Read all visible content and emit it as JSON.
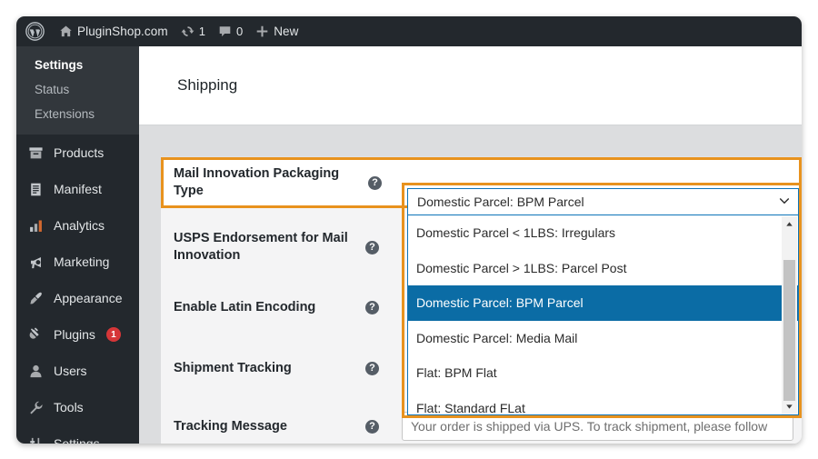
{
  "adminbar": {
    "logo_icon": "wordpress-logo-icon",
    "home_icon": "home-icon",
    "site_name": "PluginShop.com",
    "updates_icon": "updates-icon",
    "updates_count": "1",
    "comments_icon": "comments-icon",
    "comments_count": "0",
    "new_icon": "plus-icon",
    "new_label": "New"
  },
  "sidebar": {
    "submenu": [
      {
        "label": "Settings",
        "current": true
      },
      {
        "label": "Status",
        "current": false
      },
      {
        "label": "Extensions",
        "current": false
      }
    ],
    "items": [
      {
        "label": "Products",
        "icon": "products-icon"
      },
      {
        "label": "Manifest",
        "icon": "manifest-icon"
      },
      {
        "label": "Analytics",
        "icon": "analytics-icon"
      },
      {
        "label": "Marketing",
        "icon": "marketing-icon"
      },
      {
        "label": "Appearance",
        "icon": "appearance-icon"
      },
      {
        "label": "Plugins",
        "icon": "plugins-icon",
        "badge": "1"
      },
      {
        "label": "Users",
        "icon": "users-icon"
      },
      {
        "label": "Tools",
        "icon": "tools-icon"
      },
      {
        "label": "Settings",
        "icon": "settings-icon"
      }
    ]
  },
  "page": {
    "title": "Shipping"
  },
  "form": {
    "help_glyph": "?",
    "rows": [
      {
        "label": "Mail Innovation Packaging Type"
      },
      {
        "label": "USPS Endorsement for Mail Innovation"
      },
      {
        "label": "Enable Latin Encoding"
      },
      {
        "label": "Shipment Tracking"
      },
      {
        "label": "Tracking Message"
      }
    ]
  },
  "dropdown": {
    "selected_value": "Domestic Parcel: BPM Parcel",
    "chevron_icon": "chevron-down-icon",
    "scroll_up_icon": "scroll-up-arrow-icon",
    "scroll_down_icon": "scroll-down-arrow-icon",
    "options": [
      {
        "label": "Domestic Parcel < 1LBS: Irregulars",
        "selected": false
      },
      {
        "label": "Domestic Parcel > 1LBS: Parcel Post",
        "selected": false
      },
      {
        "label": "Domestic Parcel: BPM Parcel",
        "selected": true
      },
      {
        "label": "Domestic Parcel: Media Mail",
        "selected": false
      },
      {
        "label": "Flat: BPM Flat",
        "selected": false
      },
      {
        "label": "Flat: Standard FLat",
        "selected": false
      }
    ]
  },
  "tracking_message": {
    "value": "Your order is shipped via UPS. To track shipment, please follow"
  },
  "colors": {
    "highlight_orange": "#e8921e",
    "select_blue": "#0b6ca5",
    "focus_border": "#0d74b8",
    "admin_dark": "#23282d",
    "badge_red": "#d63638"
  }
}
